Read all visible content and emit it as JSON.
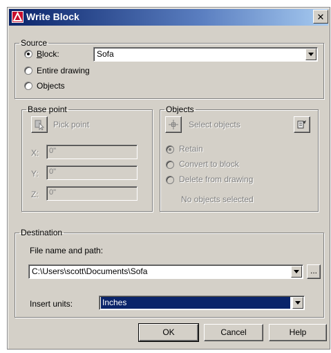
{
  "window": {
    "title": "Write Block",
    "close_glyph": "✕"
  },
  "source": {
    "legend": "Source",
    "options": [
      {
        "label": "Block:",
        "mnemonic_index": 0,
        "checked": true
      },
      {
        "label": "Entire drawing",
        "mnemonic_index": 0,
        "checked": false
      },
      {
        "label": "Objects",
        "mnemonic_index": 0,
        "checked": false
      }
    ],
    "block_value": "Sofa"
  },
  "base_point": {
    "legend": "Base point",
    "pick_label": "Pick point",
    "x_label": "X:",
    "x_value": "0\"",
    "y_label": "Y:",
    "y_value": "0\"",
    "z_label": "Z:",
    "z_value": "0\""
  },
  "objects": {
    "legend": "Objects",
    "select_label": "Select objects",
    "retain_label": "Retain",
    "convert_label": "Convert to block",
    "delete_label": "Delete from drawing",
    "status": "No objects selected"
  },
  "destination": {
    "legend": "Destination",
    "file_label": "File name and path:",
    "file_value": "C:\\Users\\scott\\Documents\\Sofa",
    "browse_label": "...",
    "units_label": "Insert units:",
    "units_value": "Inches"
  },
  "buttons": {
    "ok": "OK",
    "cancel": "Cancel",
    "help": "Help"
  },
  "colors": {
    "dialog_bg": "#d4d0c8",
    "title_bar": "#0a246a",
    "selection": "#0a246a"
  }
}
